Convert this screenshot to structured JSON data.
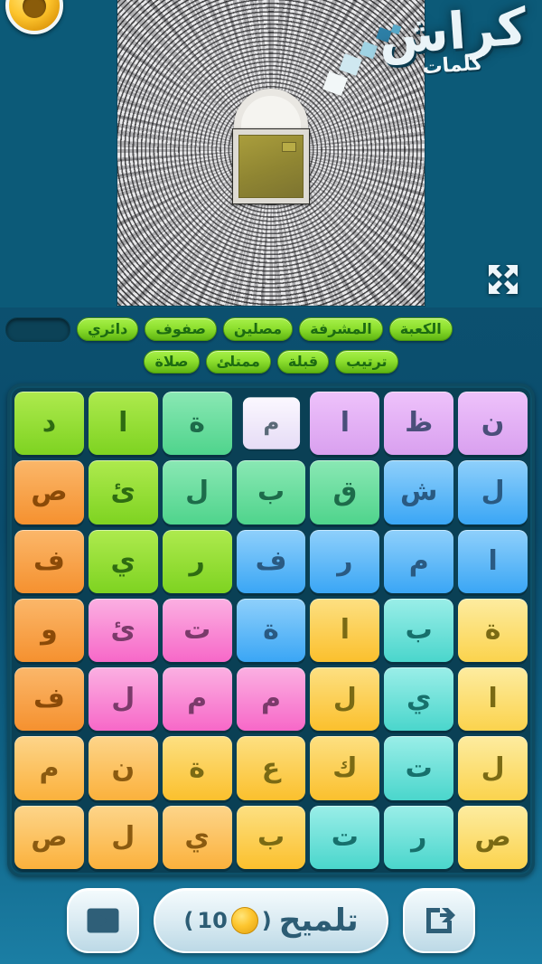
{
  "brand": {
    "main": "كراش",
    "sub": "كلمات"
  },
  "topbar": {
    "coin_icon": "coin-icon"
  },
  "stage": {
    "image_alt": "aerial-view-of-kaaba-with-circular-rows-of-worshippers",
    "expand_icon": "fullscreen-expand-icon"
  },
  "answers": {
    "rows": [
      [
        {
          "text": "",
          "solved": false
        },
        {
          "text": "دائري",
          "solved": true
        },
        {
          "text": "صفوف",
          "solved": true
        },
        {
          "text": "مصلين",
          "solved": true
        },
        {
          "text": "المشرفة",
          "solved": true
        },
        {
          "text": "الكعبة",
          "solved": true
        }
      ],
      [
        {
          "text": "صلاة",
          "solved": true
        },
        {
          "text": "ممتلئ",
          "solved": true
        },
        {
          "text": "قبلة",
          "solved": true
        },
        {
          "text": "ترتيب",
          "solved": true
        }
      ]
    ]
  },
  "grid": {
    "columns": 7,
    "tiles": [
      {
        "letter": "ن",
        "color": "#d9a0ef",
        "color2": "#eec2fb",
        "text": "#4a4f7a",
        "picked": false
      },
      {
        "letter": "ظ",
        "color": "#d9a0ef",
        "color2": "#eec2fb",
        "text": "#4a4f7a",
        "picked": false
      },
      {
        "letter": "ا",
        "color": "#d9a0ef",
        "color2": "#eec2fb",
        "text": "#4a4f7a",
        "picked": false
      },
      {
        "letter": "م",
        "color": "#e9dff8",
        "color2": "#fbf8ff",
        "text": "#5a6a78",
        "picked": true
      },
      {
        "letter": "ة",
        "color": "#4fd48c",
        "color2": "#8ae8b4",
        "text": "#1d6b4a",
        "picked": false
      },
      {
        "letter": "ا",
        "color": "#7ed321",
        "color2": "#aeea4e",
        "text": "#2e6b12",
        "picked": false
      },
      {
        "letter": "د",
        "color": "#7ed321",
        "color2": "#aeea4e",
        "text": "#2e6b12",
        "picked": false
      },
      {
        "letter": "ل",
        "color": "#3aa6f5",
        "color2": "#8fd0fb",
        "text": "#2a5a82",
        "picked": false
      },
      {
        "letter": "ش",
        "color": "#3aa6f5",
        "color2": "#8fd0fb",
        "text": "#2a5a82",
        "picked": false
      },
      {
        "letter": "ق",
        "color": "#4fd48c",
        "color2": "#8ae8b4",
        "text": "#1d6b4a",
        "picked": false
      },
      {
        "letter": "ب",
        "color": "#4fd48c",
        "color2": "#8ae8b4",
        "text": "#1d6b4a",
        "picked": false
      },
      {
        "letter": "ل",
        "color": "#4fd48c",
        "color2": "#8ae8b4",
        "text": "#1d6b4a",
        "picked": false
      },
      {
        "letter": "ئ",
        "color": "#7ed321",
        "color2": "#aeea4e",
        "text": "#2e6b12",
        "picked": false
      },
      {
        "letter": "ص",
        "color": "#f5912f",
        "color2": "#fbb76a",
        "text": "#8a4a08",
        "picked": false
      },
      {
        "letter": "ا",
        "color": "#3aa6f5",
        "color2": "#8fd0fb",
        "text": "#2a5a82",
        "picked": false
      },
      {
        "letter": "م",
        "color": "#3aa6f5",
        "color2": "#8fd0fb",
        "text": "#2a5a82",
        "picked": false
      },
      {
        "letter": "ر",
        "color": "#3aa6f5",
        "color2": "#8fd0fb",
        "text": "#2a5a82",
        "picked": false
      },
      {
        "letter": "ف",
        "color": "#3aa6f5",
        "color2": "#8fd0fb",
        "text": "#2a5a82",
        "picked": false
      },
      {
        "letter": "ر",
        "color": "#7ed321",
        "color2": "#aeea4e",
        "text": "#2e6b12",
        "picked": false
      },
      {
        "letter": "ي",
        "color": "#7ed321",
        "color2": "#aeea4e",
        "text": "#2e6b12",
        "picked": false
      },
      {
        "letter": "ف",
        "color": "#f5912f",
        "color2": "#fbb76a",
        "text": "#8a4a08",
        "picked": false
      },
      {
        "letter": "ة",
        "color": "#fbd34d",
        "color2": "#fdeca0",
        "text": "#7a6a14",
        "picked": false
      },
      {
        "letter": "ب",
        "color": "#4ad6cc",
        "color2": "#9aeee8",
        "text": "#17706c",
        "picked": false
      },
      {
        "letter": "ا",
        "color": "#fbc02d",
        "color2": "#fde082",
        "text": "#7a6a14",
        "picked": false
      },
      {
        "letter": "ة",
        "color": "#3aa6f5",
        "color2": "#8fd0fb",
        "text": "#2a5a82",
        "picked": false
      },
      {
        "letter": "ت",
        "color": "#f768c8",
        "color2": "#fbb0e2",
        "text": "#7a3a6a",
        "picked": false
      },
      {
        "letter": "ئ",
        "color": "#f768c8",
        "color2": "#fbb0e2",
        "text": "#7a3a6a",
        "picked": false
      },
      {
        "letter": "و",
        "color": "#f5912f",
        "color2": "#fbb76a",
        "text": "#8a4a08",
        "picked": false
      },
      {
        "letter": "ا",
        "color": "#fbd34d",
        "color2": "#fdeca0",
        "text": "#7a6a14",
        "picked": false
      },
      {
        "letter": "ي",
        "color": "#4ad6cc",
        "color2": "#9aeee8",
        "text": "#17706c",
        "picked": false
      },
      {
        "letter": "ل",
        "color": "#fbc02d",
        "color2": "#fde082",
        "text": "#7a6a14",
        "picked": false
      },
      {
        "letter": "م",
        "color": "#f768c8",
        "color2": "#fbb0e2",
        "text": "#7a3a6a",
        "picked": false
      },
      {
        "letter": "م",
        "color": "#f768c8",
        "color2": "#fbb0e2",
        "text": "#7a3a6a",
        "picked": false
      },
      {
        "letter": "ل",
        "color": "#f768c8",
        "color2": "#fbb0e2",
        "text": "#7a3a6a",
        "picked": false
      },
      {
        "letter": "ف",
        "color": "#f5912f",
        "color2": "#fbb76a",
        "text": "#8a4a08",
        "picked": false
      },
      {
        "letter": "ل",
        "color": "#fbd34d",
        "color2": "#fdeca0",
        "text": "#7a6a14",
        "picked": false
      },
      {
        "letter": "ت",
        "color": "#4ad6cc",
        "color2": "#9aeee8",
        "text": "#17706c",
        "picked": false
      },
      {
        "letter": "ك",
        "color": "#fbc02d",
        "color2": "#fde082",
        "text": "#7a6a14",
        "picked": false
      },
      {
        "letter": "ع",
        "color": "#fbc02d",
        "color2": "#fde082",
        "text": "#7a6a14",
        "picked": false
      },
      {
        "letter": "ة",
        "color": "#fbc02d",
        "color2": "#fde082",
        "text": "#7a6a14",
        "picked": false
      },
      {
        "letter": "ن",
        "color": "#fbb13c",
        "color2": "#fdd58a",
        "text": "#8a5a10",
        "picked": false
      },
      {
        "letter": "م",
        "color": "#fbb13c",
        "color2": "#fdd58a",
        "text": "#8a5a10",
        "picked": false
      },
      {
        "letter": "ص",
        "color": "#fbd34d",
        "color2": "#fdeca0",
        "text": "#7a6a14",
        "picked": false
      },
      {
        "letter": "ر",
        "color": "#4ad6cc",
        "color2": "#9aeee8",
        "text": "#17706c",
        "picked": false
      },
      {
        "letter": "ت",
        "color": "#4ad6cc",
        "color2": "#9aeee8",
        "text": "#17706c",
        "picked": false
      },
      {
        "letter": "ب",
        "color": "#fbc02d",
        "color2": "#fde082",
        "text": "#7a6a14",
        "picked": false
      },
      {
        "letter": "ي",
        "color": "#fbb13c",
        "color2": "#fdd58a",
        "text": "#8a5a10",
        "picked": false
      },
      {
        "letter": "ل",
        "color": "#fbb13c",
        "color2": "#fdd58a",
        "text": "#8a5a10",
        "picked": false
      },
      {
        "letter": "ص",
        "color": "#fbb13c",
        "color2": "#fdd58a",
        "text": "#8a5a10",
        "picked": false
      }
    ]
  },
  "bottom": {
    "share_icon": "share-export-icon",
    "hint_label": "تلميح",
    "hint_cost_open": "(",
    "hint_cost_value": "10",
    "hint_cost_close": ")",
    "hint_coin_icon": "coin-icon",
    "video_icon": "video-ad-icon"
  },
  "colors": {
    "background_top": "#0e5a75",
    "background_bottom": "#1b7ea4",
    "chip_green": "#8ee02f",
    "panel_dark": "#0a4055",
    "button_light": "#dcecf3"
  }
}
